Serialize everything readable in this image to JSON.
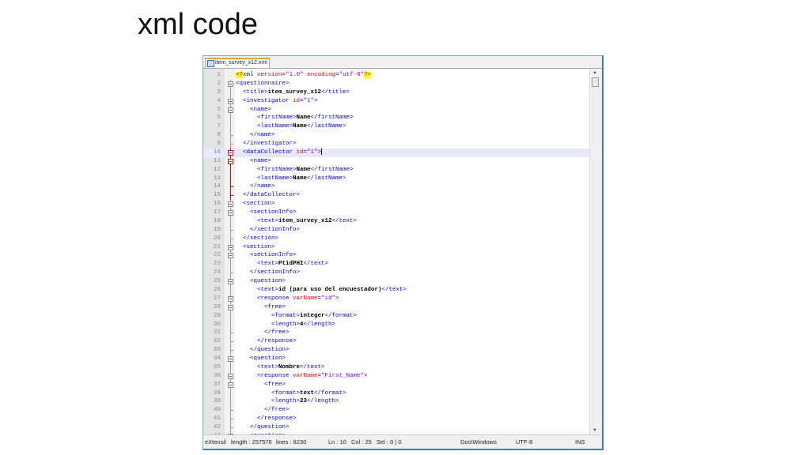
{
  "slide_title": "xml code",
  "tab": {
    "label": "item_survey_x12.xml"
  },
  "current_line": 10,
  "lines": [
    [
      0,
      "none",
      [
        [
          "pi",
          "<?"
        ],
        [
          "tag",
          "xml "
        ],
        [
          "att",
          "version"
        ],
        [
          "tag",
          "="
        ],
        [
          "val",
          "\"1.0\""
        ],
        [
          "tag",
          " "
        ],
        [
          "att",
          "encoding"
        ],
        [
          "tag",
          "="
        ],
        [
          "val",
          "\"utf-8\""
        ],
        [
          "pi",
          "?>"
        ]
      ]
    ],
    [
      0,
      "open",
      [
        [
          "tag",
          "<questionnaire>"
        ]
      ]
    ],
    [
      1,
      "mid",
      [
        [
          "tag",
          "<title>"
        ],
        [
          "txt",
          "item_survey_x12"
        ],
        [
          "tag",
          "</title>"
        ]
      ]
    ],
    [
      1,
      "open",
      [
        [
          "tag",
          "<investigator "
        ],
        [
          "att",
          "id"
        ],
        [
          "tag",
          "="
        ],
        [
          "val",
          "\"1\""
        ],
        [
          "tag",
          ">"
        ]
      ]
    ],
    [
      2,
      "open",
      [
        [
          "tag",
          "<name>"
        ]
      ]
    ],
    [
      3,
      "mid",
      [
        [
          "tag",
          "<firstName>"
        ],
        [
          "txt",
          "Name"
        ],
        [
          "tag",
          "</firstName>"
        ]
      ]
    ],
    [
      3,
      "mid",
      [
        [
          "tag",
          "<lastName>"
        ],
        [
          "txt",
          "Name"
        ],
        [
          "tag",
          "</lastName>"
        ]
      ]
    ],
    [
      2,
      "end",
      [
        [
          "tag",
          "</name>"
        ]
      ]
    ],
    [
      1,
      "end",
      [
        [
          "tag",
          "</investigator>"
        ]
      ]
    ],
    [
      1,
      "openred",
      [
        [
          "tag",
          "<dataCollector "
        ],
        [
          "att",
          "id"
        ],
        [
          "tag",
          "="
        ],
        [
          "val",
          "\"1\""
        ],
        [
          "tag",
          ">"
        ]
      ]
    ],
    [
      2,
      "openred",
      [
        [
          "tag",
          "<name>"
        ]
      ]
    ],
    [
      3,
      "midred",
      [
        [
          "tag",
          "<firstName>"
        ],
        [
          "txt",
          "Name"
        ],
        [
          "tag",
          "</firstName>"
        ]
      ]
    ],
    [
      3,
      "midred",
      [
        [
          "tag",
          "<lastName>"
        ],
        [
          "txt",
          "Name"
        ],
        [
          "tag",
          "</lastName>"
        ]
      ]
    ],
    [
      2,
      "endred",
      [
        [
          "tag",
          "</name>"
        ]
      ]
    ],
    [
      1,
      "endred",
      [
        [
          "tag",
          "</dataCollector>"
        ]
      ]
    ],
    [
      1,
      "open",
      [
        [
          "tag",
          "<section>"
        ]
      ]
    ],
    [
      2,
      "open",
      [
        [
          "tag",
          "<sectionInfo>"
        ]
      ]
    ],
    [
      3,
      "mid",
      [
        [
          "tag",
          "<text>"
        ],
        [
          "txt",
          "item_survey_x12"
        ],
        [
          "tag",
          "</text>"
        ]
      ]
    ],
    [
      2,
      "end",
      [
        [
          "tag",
          "</sectionInfo>"
        ]
      ]
    ],
    [
      1,
      "end",
      [
        [
          "tag",
          "</section>"
        ]
      ]
    ],
    [
      1,
      "open",
      [
        [
          "tag",
          "<section>"
        ]
      ]
    ],
    [
      2,
      "open",
      [
        [
          "tag",
          "<sectionInfo>"
        ]
      ]
    ],
    [
      3,
      "mid",
      [
        [
          "tag",
          "<text>"
        ],
        [
          "txt",
          "PtidPHI"
        ],
        [
          "tag",
          "</text>"
        ]
      ]
    ],
    [
      2,
      "end",
      [
        [
          "tag",
          "</sectionInfo>"
        ]
      ]
    ],
    [
      2,
      "open",
      [
        [
          "tag",
          "<question>"
        ]
      ]
    ],
    [
      3,
      "mid",
      [
        [
          "tag",
          "<text>"
        ],
        [
          "txt",
          "id (para uso del encuestador)"
        ],
        [
          "tag",
          "</text>"
        ]
      ]
    ],
    [
      3,
      "open",
      [
        [
          "tag",
          "<response "
        ],
        [
          "att",
          "varName"
        ],
        [
          "tag",
          "="
        ],
        [
          "val",
          "\"id\""
        ],
        [
          "tag",
          ">"
        ]
      ]
    ],
    [
      4,
      "open",
      [
        [
          "tag",
          "<free>"
        ]
      ]
    ],
    [
      5,
      "mid",
      [
        [
          "tag",
          "<format>"
        ],
        [
          "txt",
          "integer"
        ],
        [
          "tag",
          "</format>"
        ]
      ]
    ],
    [
      5,
      "mid",
      [
        [
          "tag",
          "<length>"
        ],
        [
          "txt",
          "4"
        ],
        [
          "tag",
          "</length>"
        ]
      ]
    ],
    [
      4,
      "end",
      [
        [
          "tag",
          "</free>"
        ]
      ]
    ],
    [
      3,
      "end",
      [
        [
          "tag",
          "</response>"
        ]
      ]
    ],
    [
      2,
      "end",
      [
        [
          "tag",
          "</question>"
        ]
      ]
    ],
    [
      2,
      "open",
      [
        [
          "tag",
          "<question>"
        ]
      ]
    ],
    [
      3,
      "mid",
      [
        [
          "tag",
          "<text>"
        ],
        [
          "txt",
          "Nombre"
        ],
        [
          "tag",
          "</text>"
        ]
      ]
    ],
    [
      3,
      "open",
      [
        [
          "tag",
          "<response "
        ],
        [
          "att",
          "varName"
        ],
        [
          "tag",
          "="
        ],
        [
          "val",
          "\"First_Name\""
        ],
        [
          "tag",
          ">"
        ]
      ]
    ],
    [
      4,
      "open",
      [
        [
          "tag",
          "<free>"
        ]
      ]
    ],
    [
      5,
      "mid",
      [
        [
          "tag",
          "<format>"
        ],
        [
          "txt",
          "text"
        ],
        [
          "tag",
          "</format>"
        ]
      ]
    ],
    [
      5,
      "mid",
      [
        [
          "tag",
          "<length>"
        ],
        [
          "txt",
          "23"
        ],
        [
          "tag",
          "</length>"
        ]
      ]
    ],
    [
      4,
      "end",
      [
        [
          "tag",
          "</free>"
        ]
      ]
    ],
    [
      3,
      "end",
      [
        [
          "tag",
          "</response>"
        ]
      ]
    ],
    [
      2,
      "end",
      [
        [
          "tag",
          "</question>"
        ]
      ]
    ],
    [
      2,
      "open",
      [
        [
          "tag",
          "<question>"
        ]
      ]
    ]
  ],
  "status": {
    "type": "eXtensil",
    "length": "length : 257576",
    "lines": "lines : 8230",
    "ln": "Ln : 10",
    "col": "Col : 25",
    "sel": "Sel : 0 | 0",
    "eol": "Dos\\Windows",
    "encoding": "UTF-8",
    "mode": "INS"
  }
}
